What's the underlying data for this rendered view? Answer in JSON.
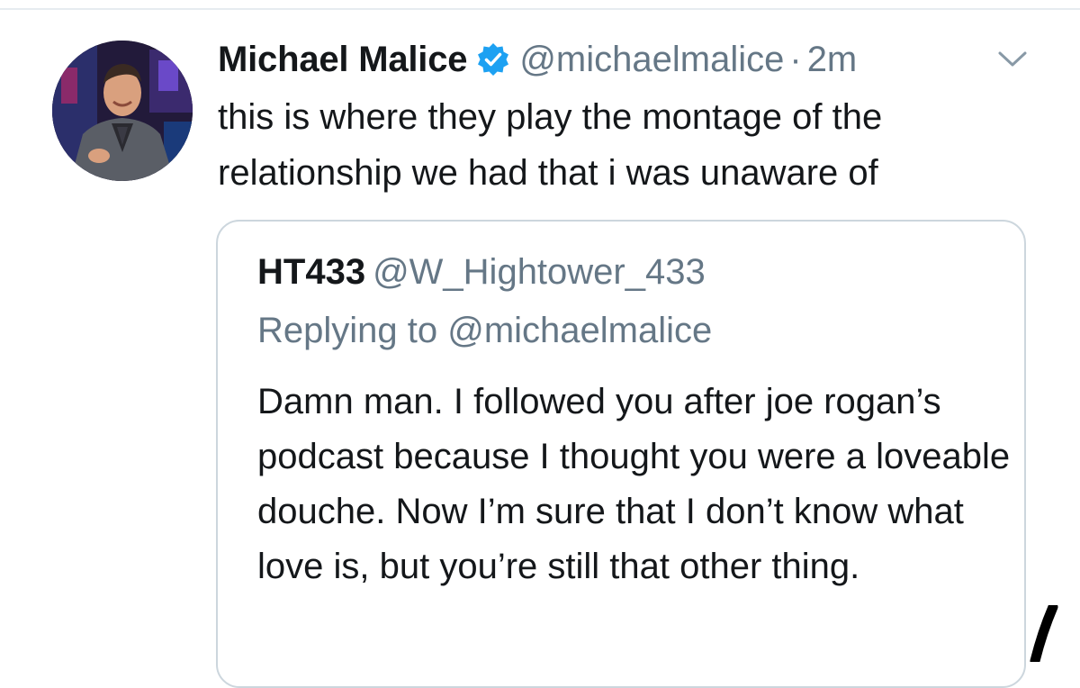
{
  "tweet": {
    "display_name": "Michael Malice",
    "verified_icon": "verified-badge-icon",
    "handle": "@michaelmalice",
    "separator": "·",
    "time": "2m",
    "text": "this is where they play the montage of the relationship we had that i was unaware of"
  },
  "quoted_tweet": {
    "display_name": "HT433",
    "handle": "@W_Hightower_433",
    "replying_to": "Replying to @michaelmalice",
    "text": "Damn man. I followed you after joe rogan’s podcast because I thought you were a loveable douche. Now I’m sure that I don’t know what love is, but you’re still that other thing."
  },
  "colors": {
    "text": "#14171a",
    "secondary": "#657786",
    "verified": "#1da1f2",
    "border": "#ccd6dd"
  }
}
